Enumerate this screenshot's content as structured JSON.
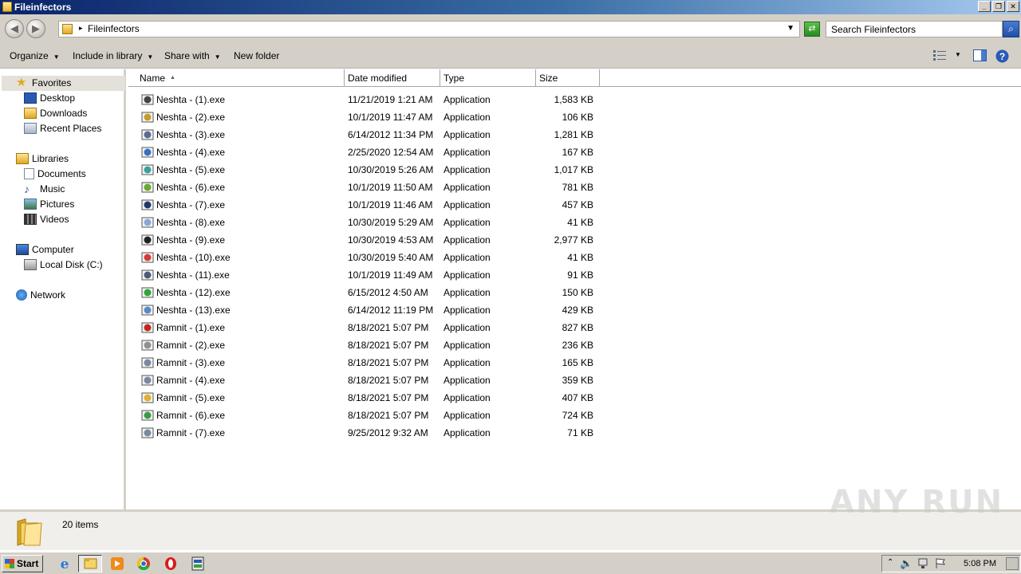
{
  "window": {
    "title": "Fileinfectors",
    "min_label": "_",
    "max_label": "❐",
    "close_label": "✕"
  },
  "address": {
    "path": "Fileinfectors",
    "search_placeholder": "Search Fileinfectors"
  },
  "toolbar": {
    "organize": "Organize",
    "include_in_library": "Include in library",
    "share_with": "Share with",
    "new_folder": "New folder"
  },
  "nav": {
    "favorites": "Favorites",
    "desktop": "Desktop",
    "downloads": "Downloads",
    "recent_places": "Recent Places",
    "libraries": "Libraries",
    "documents": "Documents",
    "music": "Music",
    "pictures": "Pictures",
    "videos": "Videos",
    "computer": "Computer",
    "local_disk": "Local Disk (C:)",
    "network": "Network"
  },
  "columns": {
    "name": "Name",
    "date_modified": "Date modified",
    "type": "Type",
    "size": "Size"
  },
  "files": [
    {
      "name": "Neshta - (1).exe",
      "date": "11/21/2019 1:21 AM",
      "type": "Application",
      "size": "1,583 KB",
      "icon": "app-icon-1",
      "color": "#444444"
    },
    {
      "name": "Neshta - (2).exe",
      "date": "10/1/2019 11:47 AM",
      "type": "Application",
      "size": "106 KB",
      "icon": "app-icon-2",
      "color": "#c89a2a"
    },
    {
      "name": "Neshta - (3).exe",
      "date": "6/14/2012 11:34 PM",
      "type": "Application",
      "size": "1,281 KB",
      "icon": "app-icon-3",
      "color": "#5a6a90"
    },
    {
      "name": "Neshta - (4).exe",
      "date": "2/25/2020 12:54 AM",
      "type": "Application",
      "size": "167 KB",
      "icon": "app-icon-4",
      "color": "#3a6ec8"
    },
    {
      "name": "Neshta - (5).exe",
      "date": "10/30/2019 5:26 AM",
      "type": "Application",
      "size": "1,017 KB",
      "icon": "app-icon-5",
      "color": "#3aa0a0"
    },
    {
      "name": "Neshta - (6).exe",
      "date": "10/1/2019 11:50 AM",
      "type": "Application",
      "size": "781 KB",
      "icon": "app-icon-6",
      "color": "#6aa830"
    },
    {
      "name": "Neshta - (7).exe",
      "date": "10/1/2019 11:46 AM",
      "type": "Application",
      "size": "457 KB",
      "icon": "app-icon-7",
      "color": "#1f3a6a"
    },
    {
      "name": "Neshta - (8).exe",
      "date": "10/30/2019 5:29 AM",
      "type": "Application",
      "size": "41 KB",
      "icon": "app-icon-8",
      "color": "#8aa8d8"
    },
    {
      "name": "Neshta - (9).exe",
      "date": "10/30/2019 4:53 AM",
      "type": "Application",
      "size": "2,977 KB",
      "icon": "app-icon-9",
      "color": "#222222"
    },
    {
      "name": "Neshta - (10).exe",
      "date": "10/30/2019 5:40 AM",
      "type": "Application",
      "size": "41 KB",
      "icon": "app-icon-10",
      "color": "#d83a3a"
    },
    {
      "name": "Neshta - (11).exe",
      "date": "10/1/2019 11:49 AM",
      "type": "Application",
      "size": "91 KB",
      "icon": "app-icon-11",
      "color": "#4a5a7a"
    },
    {
      "name": "Neshta - (12).exe",
      "date": "6/15/2012 4:50 AM",
      "type": "Application",
      "size": "150 KB",
      "icon": "app-icon-12",
      "color": "#2aa83a"
    },
    {
      "name": "Neshta - (13).exe",
      "date": "6/14/2012 11:19 PM",
      "type": "Application",
      "size": "429 KB",
      "icon": "app-icon-13",
      "color": "#5a8ac8"
    },
    {
      "name": "Ramnit - (1).exe",
      "date": "8/18/2021 5:07 PM",
      "type": "Application",
      "size": "827 KB",
      "icon": "app-icon-14",
      "color": "#c0281a"
    },
    {
      "name": "Ramnit - (2).exe",
      "date": "8/18/2021 5:07 PM",
      "type": "Application",
      "size": "236 KB",
      "icon": "app-icon-15",
      "color": "#909090"
    },
    {
      "name": "Ramnit - (3).exe",
      "date": "8/18/2021 5:07 PM",
      "type": "Application",
      "size": "165 KB",
      "icon": "app-icon-16",
      "color": "#7a8aa0"
    },
    {
      "name": "Ramnit - (4).exe",
      "date": "8/18/2021 5:07 PM",
      "type": "Application",
      "size": "359 KB",
      "icon": "app-icon-17",
      "color": "#7a8aa0"
    },
    {
      "name": "Ramnit - (5).exe",
      "date": "8/18/2021 5:07 PM",
      "type": "Application",
      "size": "407 KB",
      "icon": "app-icon-18",
      "color": "#e0b030"
    },
    {
      "name": "Ramnit - (6).exe",
      "date": "8/18/2021 5:07 PM",
      "type": "Application",
      "size": "724 KB",
      "icon": "app-icon-19",
      "color": "#3a9a4a"
    },
    {
      "name": "Ramnit - (7).exe",
      "date": "9/25/2012 9:32 AM",
      "type": "Application",
      "size": "71 KB",
      "icon": "app-icon-20",
      "color": "#7a8aa0"
    }
  ],
  "details": {
    "item_count": "20 items"
  },
  "watermark": "ANY RUN",
  "taskbar": {
    "start": "Start",
    "clock": "5:08 PM",
    "tasks": [
      "internet-explorer-icon",
      "explorer-icon",
      "media-player-icon",
      "chrome-icon",
      "opera-icon",
      "app-icon"
    ]
  }
}
